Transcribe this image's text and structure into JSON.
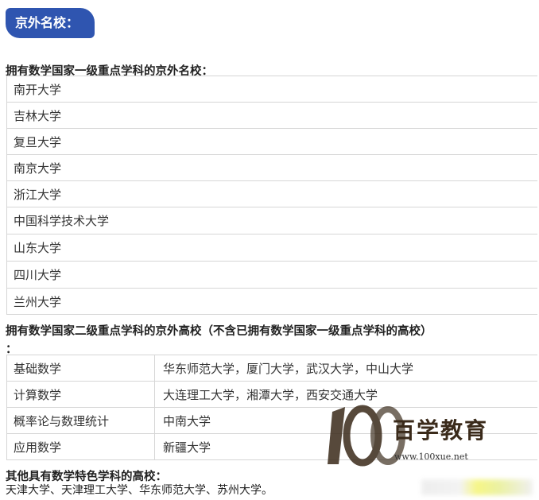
{
  "badge": "京外名校：",
  "section1": {
    "heading": "拥有数学国家一级重点学科的京外名校：",
    "schools": [
      "南开大学",
      "吉林大学",
      "复旦大学",
      "南京大学",
      "浙江大学",
      "中国科学技术大学",
      "山东大学",
      "四川大学",
      "兰州大学"
    ]
  },
  "section2": {
    "heading": "拥有数学国家二级重点学科的京外高校（不含已拥有数学国家一级重点学科的高校）",
    "heading_tail": "：",
    "rows": [
      {
        "subject": "基础数学",
        "schools": "华东师范大学，厦门大学，武汉大学，中山大学"
      },
      {
        "subject": "计算数学",
        "schools": "大连理工大学，湘潭大学，西安交通大学"
      },
      {
        "subject": "概率论与数理统计",
        "schools": "中南大学"
      },
      {
        "subject": "应用数学",
        "schools": "新疆大学"
      }
    ]
  },
  "section3": {
    "heading": "其他具有数学特色学科的高校：",
    "text": "天津大学、天津理工大学、华东师范大学、苏州大学。"
  },
  "watermark": {
    "number": "100",
    "name": "百学教育",
    "url": "www.100xue.net"
  }
}
